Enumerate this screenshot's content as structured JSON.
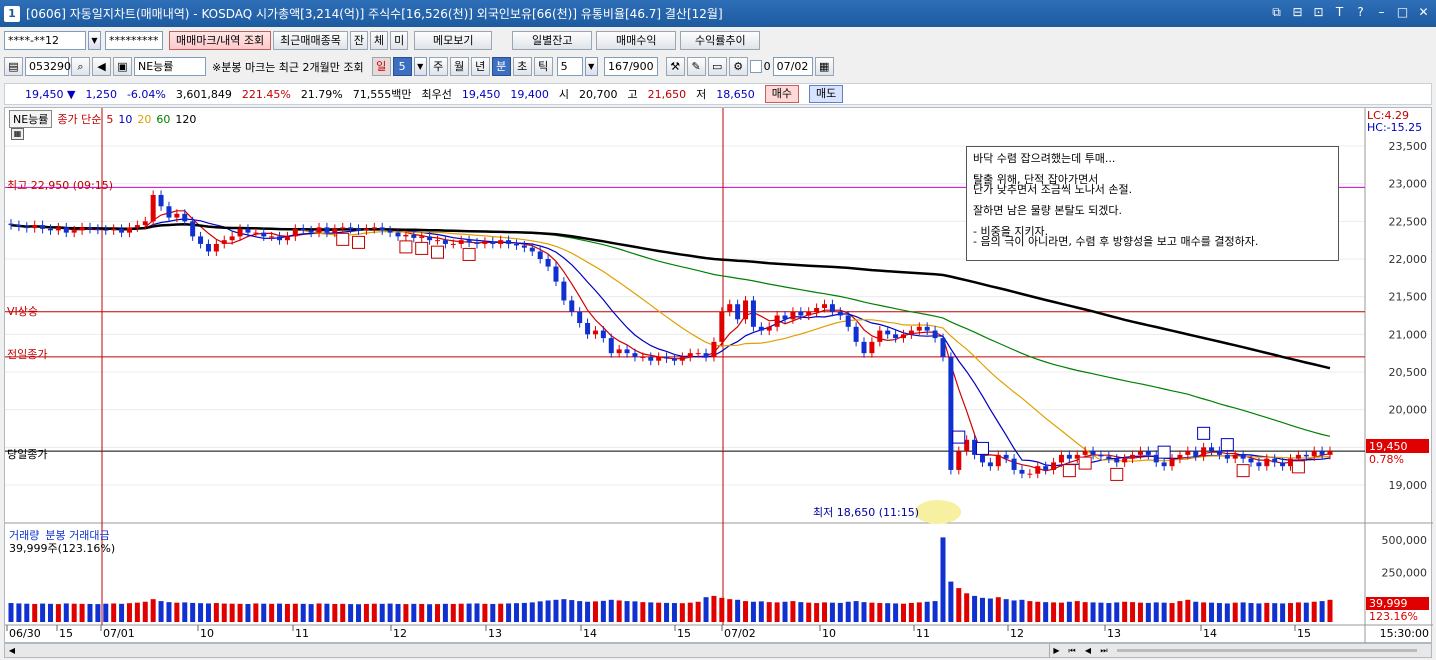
{
  "window": {
    "icon_label": "1",
    "title": "[0606] 자동일지차트(매매내역) - KOSDAQ 시가총액[3,214(억)] 주식수[16,526(천)] 외국인보유[66(천)] 유통비율[46.7] 결산[12월]",
    "controls": [
      "⧉",
      "⊟",
      "⊡",
      "T",
      "?",
      "–",
      "□",
      "✕"
    ]
  },
  "toolbar1": {
    "account": "****-**12",
    "password": "*********",
    "buttons": [
      "매매마크/내역 조회",
      "최근매매종목",
      "잔",
      "체",
      "미",
      "메모보기"
    ],
    "right_buttons": [
      "일별잔고",
      "매매수익",
      "수익률추이"
    ]
  },
  "toolbar2": {
    "code": "053290",
    "name": "NE능률",
    "notice": "※분봉 마크는 최근 2개월만 조회",
    "periods": [
      "일",
      "5",
      "주",
      "월",
      "년",
      "분",
      "초",
      "틱"
    ],
    "interval": "5",
    "count": "167/900",
    "date": "07/02",
    "check_label": "0"
  },
  "quote": {
    "price": "19,450 ▼",
    "change": "1,250",
    "rate": "-6.04%",
    "volume": "3,601,849",
    "vol_ratio": "221.45%",
    "turnover": "21.79%",
    "amount": "71,555백만",
    "priority_label": "최우선",
    "ask": "19,450",
    "bid": "19,400",
    "open_label": "시",
    "open": "20,700",
    "high_label": "고",
    "high": "21,650",
    "low_label": "저",
    "low": "18,650",
    "buy": "매수",
    "sell": "매도"
  },
  "legend": {
    "stock": "NE능률",
    "ma_label": "종가 단순",
    "ma": [
      {
        "n": "5",
        "color": "#d00000"
      },
      {
        "n": "10",
        "color": "#0000c0"
      },
      {
        "n": "20",
        "color": "#e0a000"
      },
      {
        "n": "60",
        "color": "#008000"
      },
      {
        "n": "120",
        "color": "#000000"
      }
    ]
  },
  "hlines": {
    "high_label": "최고 22,950 (09:15)",
    "vi_label": "VI상승",
    "prev_close_label": "전일종가",
    "today_close_label": "당일종가",
    "low_label": "최저 18,650 (11:15)"
  },
  "right_axis": {
    "lc": "LC:4.29",
    "hc": "HC:-15.25",
    "ticks": [
      "23,500",
      "23,000",
      "22,500",
      "22,000",
      "21,500",
      "21,000",
      "20,500",
      "20,000",
      "19,500",
      "19,000"
    ],
    "current_price": "19,450",
    "current_rate": "0.78%"
  },
  "volume_panel": {
    "title1": "거래량",
    "title2": "분봉 거래대금",
    "value": "39,999주(123.16%)",
    "ticks": [
      "500,000",
      "250,000"
    ],
    "current": "39,999",
    "current_rate": "123.16%"
  },
  "x_axis": {
    "labels": [
      "06/30",
      "15",
      "07/01",
      "10",
      "11",
      "12",
      "13",
      "14",
      "15",
      "07/02",
      "10",
      "11",
      "12",
      "13",
      "14",
      "15"
    ],
    "time": "15:30:00"
  },
  "memo": [
    "바닥 수렴 잡으려했는데 투매...",
    "탈출 위해, 단적 잡아가면서",
    "단가 낮추면서 조금씩 노나서 손절.",
    "잘하면 남은 물량 본탈도 되겠다.",
    "- 비중을 지키자.",
    "- 음의 극이 아니라면, 수렴 후 방향성을 보고 매수를 결정하자."
  ],
  "colors": {
    "up": "#e00000",
    "down": "#1030d0",
    "title": "#1d5aa0"
  },
  "chart_data": {
    "type": "candlestick",
    "title": "",
    "ylim": [
      18500,
      23700
    ],
    "ma_series_names": [
      "5",
      "10",
      "20",
      "60",
      "120"
    ],
    "closes": [
      22450,
      22430,
      22410,
      22450,
      22400,
      22380,
      22420,
      22350,
      22380,
      22420,
      22400,
      22390,
      22380,
      22400,
      22350,
      22420,
      22450,
      22500,
      22850,
      22700,
      22550,
      22600,
      22500,
      22300,
      22200,
      22100,
      22200,
      22250,
      22300,
      22400,
      22350,
      22350,
      22300,
      22300,
      22250,
      22300,
      22400,
      22380,
      22350,
      22420,
      22350,
      22400,
      22420,
      22400,
      22380,
      22400,
      22420,
      22380,
      22350,
      22300,
      22320,
      22280,
      22300,
      22250,
      22250,
      22200,
      22200,
      22250,
      22220,
      22200,
      22230,
      22200,
      22250,
      22200,
      22180,
      22150,
      22100,
      22000,
      21900,
      21700,
      21450,
      21300,
      21150,
      21000,
      21050,
      20950,
      20750,
      20800,
      20750,
      20700,
      20700,
      20650,
      20700,
      20680,
      20650,
      20700,
      20750,
      20750,
      20700,
      20900,
      21300,
      21400,
      21200,
      21450,
      21100,
      21050,
      21100,
      21250,
      21200,
      21300,
      21250,
      21300,
      21350,
      21400,
      21300,
      21250,
      21100,
      20900,
      20750,
      20900,
      21050,
      21000,
      20950,
      21000,
      21050,
      21100,
      21050,
      20950,
      20700,
      19200,
      19450,
      19600,
      19400,
      19300,
      19250,
      19400,
      19350,
      19200,
      19150,
      19150,
      19250,
      19200,
      19300,
      19400,
      19350,
      19400,
      19450,
      19400,
      19380,
      19350,
      19300,
      19350,
      19400,
      19450,
      19400,
      19300,
      19250,
      19350,
      19400,
      19450,
      19380,
      19500,
      19450,
      19400,
      19350,
      19400,
      19350,
      19300,
      19250,
      19350,
      19300,
      19250,
      19350,
      19400,
      19380,
      19450,
      19400,
      19450
    ],
    "volumes": [
      15000,
      12000,
      10000,
      8000,
      11000,
      9000,
      7000,
      12000,
      10000,
      9000,
      8000,
      7000,
      10000,
      12000,
      9000,
      14000,
      18000,
      25000,
      45000,
      30000,
      22000,
      18000,
      20000,
      16000,
      14000,
      12000,
      15000,
      11000,
      10000,
      9000,
      8000,
      12000,
      10000,
      9000,
      11000,
      8000,
      10000,
      9000,
      7000,
      12000,
      10000,
      8000,
      9000,
      7000,
      6000,
      8000,
      10000,
      9000,
      11000,
      8000,
      7000,
      9000,
      8000,
      6000,
      7000,
      9000,
      8000,
      10000,
      11000,
      12000,
      9000,
      8000,
      10000,
      12000,
      14000,
      16000,
      20000,
      28000,
      35000,
      40000,
      45000,
      38000,
      30000,
      25000,
      28000,
      32000,
      40000,
      35000,
      30000,
      28000,
      22000,
      20000,
      18000,
      16000,
      15000,
      14000,
      18000,
      25000,
      60000,
      70000,
      55000,
      45000,
      40000,
      30000,
      25000,
      28000,
      22000,
      20000,
      25000,
      30000,
      22000,
      18000,
      15000,
      20000,
      18000,
      16000,
      25000,
      30000,
      22000,
      18000,
      15000,
      14000,
      12000,
      10000,
      16000,
      20000,
      25000,
      30000,
      520000,
      180000,
      130000,
      90000,
      70000,
      55000,
      50000,
      60000,
      45000,
      35000,
      40000,
      30000,
      25000,
      22000,
      20000,
      18000,
      25000,
      30000,
      22000,
      20000,
      18000,
      15000,
      20000,
      25000,
      22000,
      18000,
      16000,
      20000,
      18000,
      15000,
      30000,
      40000,
      25000,
      20000,
      18000,
      15000,
      12000,
      18000,
      20000,
      15000,
      12000,
      16000,
      14000,
      12000,
      15000,
      20000,
      18000,
      25000,
      30000,
      39999
    ]
  }
}
